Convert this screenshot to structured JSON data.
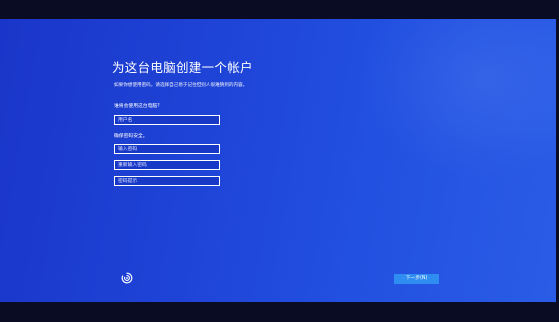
{
  "setup": {
    "title": "为这台电脑创建一个帐户",
    "description": "如果你想使用密码，请选择自己易于记住但别人很难猜到的内容。",
    "user_prompt": "谁将会使用这台电脑?",
    "password_prompt": "确保密码安全。"
  },
  "fields": {
    "username_placeholder": "用户名",
    "password_placeholder": "输入密码",
    "confirm_placeholder": "重新输入密码",
    "hint_placeholder": "密码提示"
  },
  "buttons": {
    "next_label": "下一步(N)"
  },
  "icons": {
    "ease_of_access": "ease-of-access-icon"
  },
  "colors": {
    "background": "#1e43d6",
    "next_button": "#2f8cf0",
    "text": "#ffffff"
  }
}
